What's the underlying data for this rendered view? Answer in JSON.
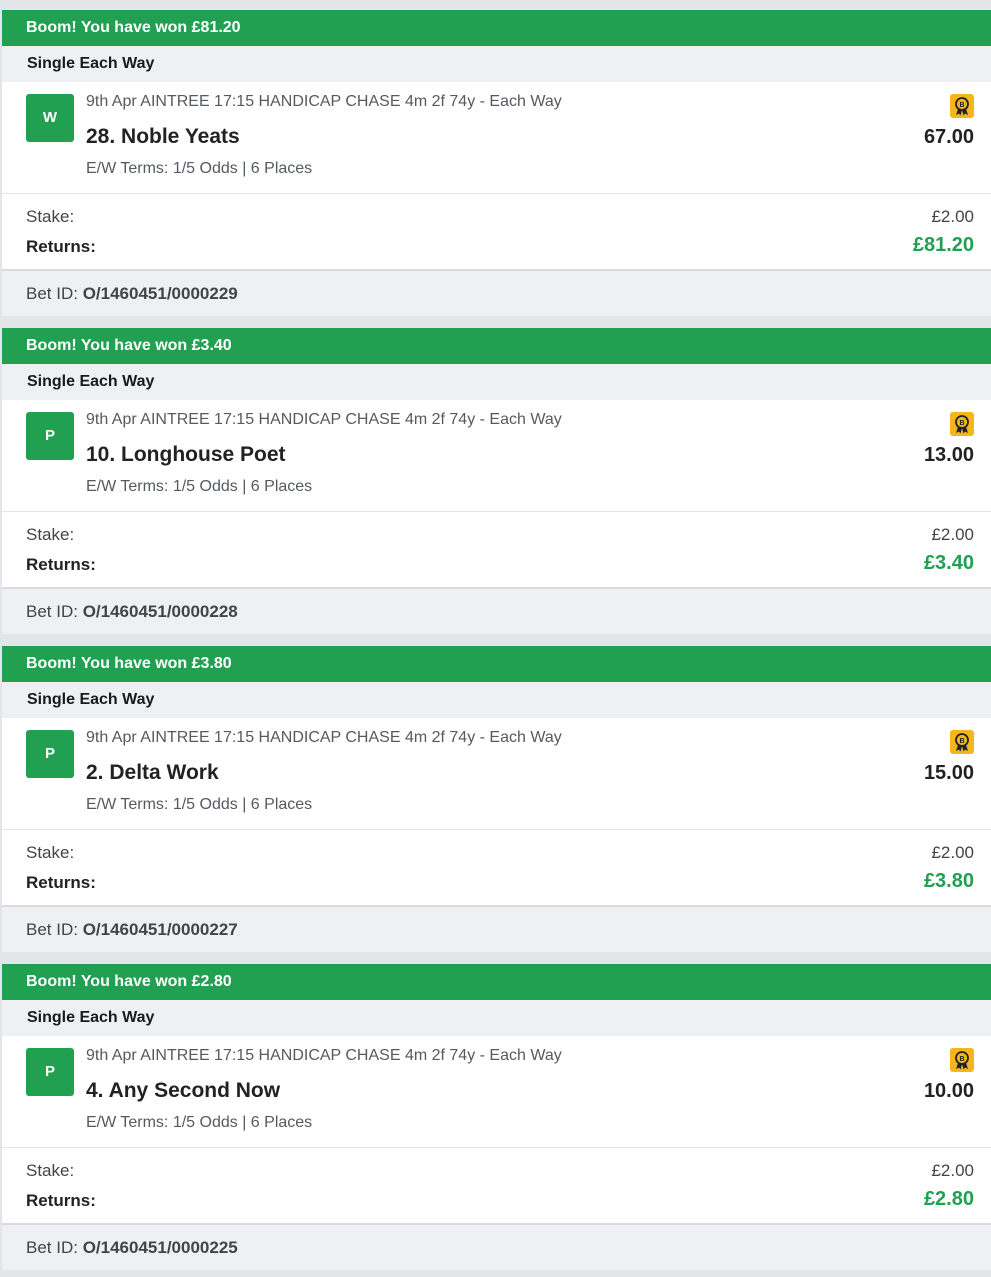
{
  "bets": [
    {
      "banner": "Boom! You have won £81.20",
      "bet_type": "Single Each Way",
      "result": "W",
      "event": "9th Apr AINTREE 17:15 HANDICAP CHASE 4m 2f 74y - Each Way",
      "runner": "28. Noble Yeats",
      "ew_terms": "E/W Terms: 1/5 Odds | 6 Places",
      "odds": "67.00",
      "stake_label": "Stake:",
      "stake": "£2.00",
      "returns_label": "Returns:",
      "returns": "£81.20",
      "bet_id_label": "Bet ID:",
      "bet_id": "O/1460451/0000229"
    },
    {
      "banner": "Boom! You have won £3.40",
      "bet_type": "Single Each Way",
      "result": "P",
      "event": "9th Apr AINTREE 17:15 HANDICAP CHASE 4m 2f 74y - Each Way",
      "runner": "10. Longhouse Poet",
      "ew_terms": "E/W Terms: 1/5 Odds | 6 Places",
      "odds": "13.00",
      "stake_label": "Stake:",
      "stake": "£2.00",
      "returns_label": "Returns:",
      "returns": "£3.40",
      "bet_id_label": "Bet ID:",
      "bet_id": "O/1460451/0000228"
    },
    {
      "banner": "Boom! You have won £3.80",
      "bet_type": "Single Each Way",
      "result": "P",
      "event": "9th Apr AINTREE 17:15 HANDICAP CHASE 4m 2f 74y - Each Way",
      "runner": "2. Delta Work",
      "ew_terms": "E/W Terms: 1/5 Odds | 6 Places",
      "odds": "15.00",
      "stake_label": "Stake:",
      "stake": "£2.00",
      "returns_label": "Returns:",
      "returns": "£3.80",
      "bet_id_label": "Bet ID:",
      "bet_id": "O/1460451/0000227"
    },
    {
      "banner": "Boom! You have won £2.80",
      "bet_type": "Single Each Way",
      "result": "P",
      "event": "9th Apr AINTREE 17:15 HANDICAP CHASE 4m 2f 74y - Each Way",
      "runner": "4. Any Second Now",
      "ew_terms": "E/W Terms: 1/5 Odds | 6 Places",
      "odds": "10.00",
      "stake_label": "Stake:",
      "stake": "£2.00",
      "returns_label": "Returns:",
      "returns": "£2.80",
      "bet_id_label": "Bet ID:",
      "bet_id": "O/1460451/0000225"
    }
  ],
  "icons": {
    "boost": "boost-badge-icon"
  },
  "colors": {
    "win_green": "#21a052",
    "boost_gold": "#f5b51c"
  }
}
